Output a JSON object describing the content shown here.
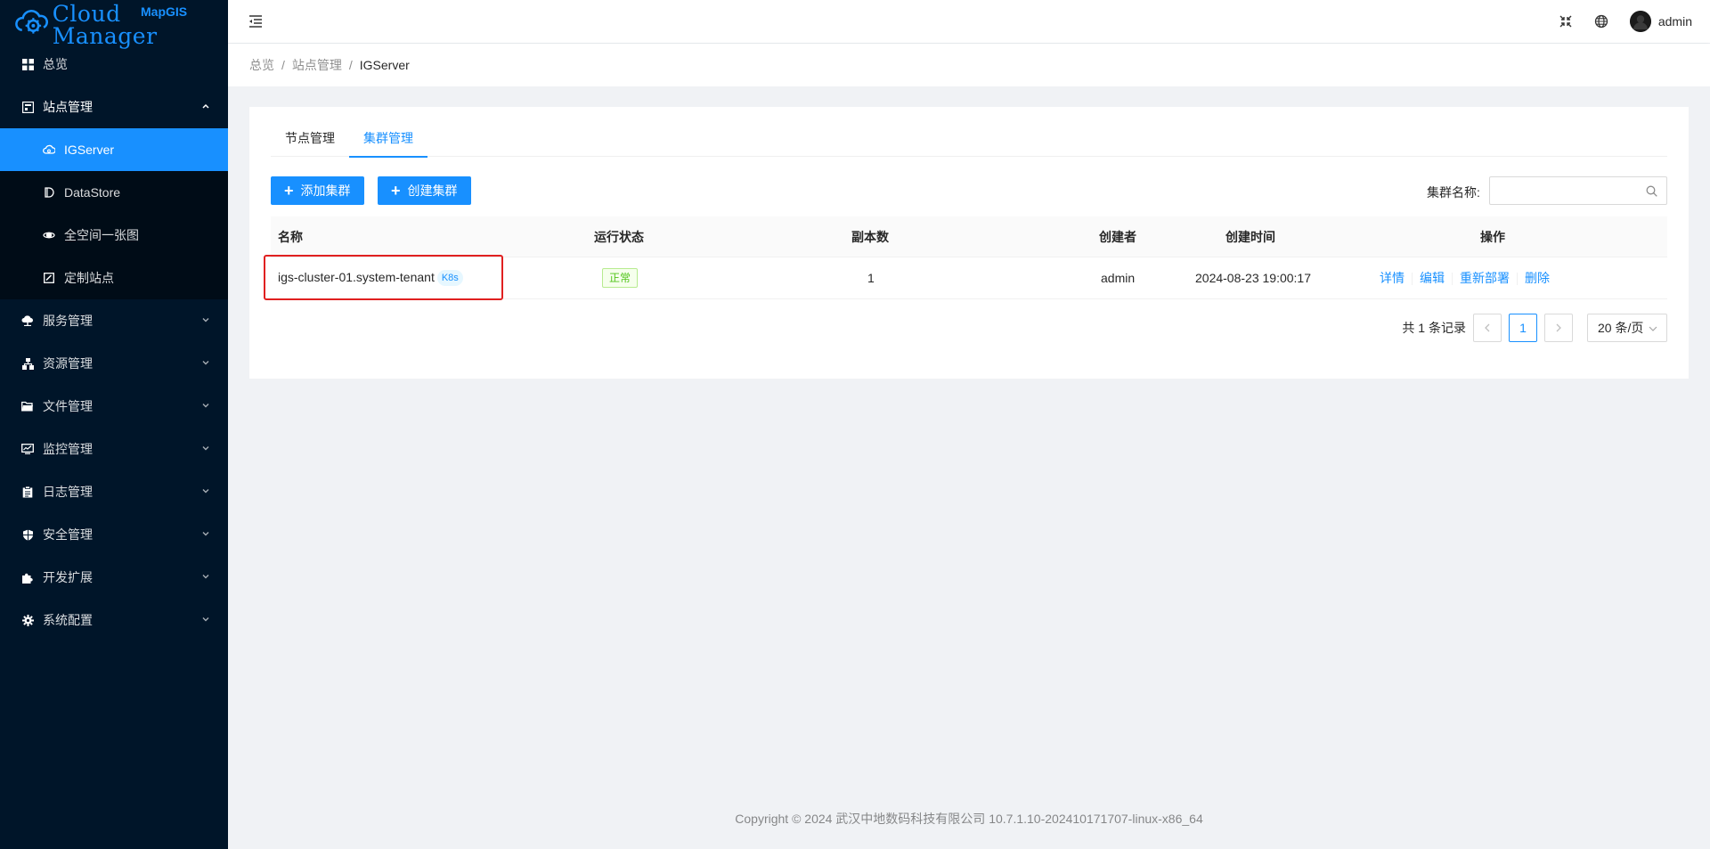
{
  "logo": {
    "superscript": "MapGIS",
    "text": "Cloud Manager"
  },
  "sidebar": {
    "items": [
      {
        "label": "总览",
        "icon": "dashboard-icon"
      },
      {
        "label": "站点管理",
        "icon": "site-icon",
        "expanded": true,
        "children": [
          {
            "label": "IGServer",
            "icon": "cloud-icon",
            "active": true
          },
          {
            "label": "DataStore",
            "icon": "datastore-icon"
          },
          {
            "label": "全空间一张图",
            "icon": "globe-icon"
          },
          {
            "label": "定制站点",
            "icon": "custom-site-icon"
          }
        ]
      },
      {
        "label": "服务管理",
        "icon": "service-icon"
      },
      {
        "label": "资源管理",
        "icon": "resource-icon"
      },
      {
        "label": "文件管理",
        "icon": "folder-icon"
      },
      {
        "label": "监控管理",
        "icon": "monitor-icon"
      },
      {
        "label": "日志管理",
        "icon": "log-icon"
      },
      {
        "label": "安全管理",
        "icon": "shield-icon"
      },
      {
        "label": "开发扩展",
        "icon": "puzzle-icon"
      },
      {
        "label": "系统配置",
        "icon": "gear-icon"
      }
    ]
  },
  "header": {
    "user": "admin"
  },
  "breadcrumb": {
    "items": [
      "总览",
      "站点管理",
      "IGServer"
    ]
  },
  "tabs": [
    "节点管理",
    "集群管理"
  ],
  "toolbar": {
    "add_label": "添加集群",
    "create_label": "创建集群",
    "search_label": "集群名称:",
    "search_value": ""
  },
  "table": {
    "columns": [
      "名称",
      "运行状态",
      "副本数",
      "创建者",
      "创建时间",
      "操作"
    ],
    "rows": [
      {
        "name": "igs-cluster-01.system-tenant",
        "tag": "K8s",
        "status": "正常",
        "replicas": "1",
        "creator": "admin",
        "created": "2024-08-23 19:00:17",
        "actions": [
          "详情",
          "编辑",
          "重新部署",
          "删除"
        ]
      }
    ]
  },
  "pagination": {
    "total_text": "共 1 条记录",
    "current": "1",
    "page_size": "20 条/页"
  },
  "footer": {
    "text": "Copyright © 2024 武汉中地数码科技有限公司 10.7.1.10-202410171707-linux-x86_64"
  },
  "colors": {
    "primary": "#1890ff",
    "sidebar_bg": "#001529",
    "submenu_bg": "#000c17",
    "success": "#52c41a",
    "highlight": "#e02020"
  }
}
